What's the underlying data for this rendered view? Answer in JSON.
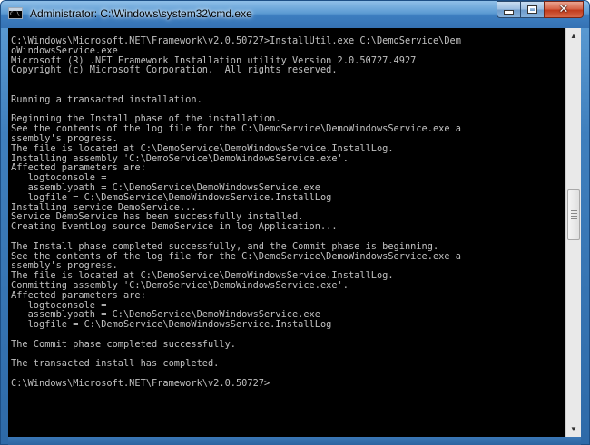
{
  "window": {
    "title": "Administrator: C:\\Windows\\system32\\cmd.exe",
    "icon": "cmd-icon",
    "icon_text": "C:\\"
  },
  "controls": {
    "minimize_icon": "minimize-icon",
    "maximize_icon": "maximize-icon",
    "close_icon": "close-icon",
    "close_glyph": "✕"
  },
  "console": {
    "lines": [
      "C:\\Windows\\Microsoft.NET\\Framework\\v2.0.50727>InstallUtil.exe C:\\DemoService\\Dem",
      "oWindowsService.exe",
      "Microsoft (R) .NET Framework Installation utility Version 2.0.50727.4927",
      "Copyright (c) Microsoft Corporation.  All rights reserved.",
      "",
      "",
      "Running a transacted installation.",
      "",
      "Beginning the Install phase of the installation.",
      "See the contents of the log file for the C:\\DemoService\\DemoWindowsService.exe a",
      "ssembly's progress.",
      "The file is located at C:\\DemoService\\DemoWindowsService.InstallLog.",
      "Installing assembly 'C:\\DemoService\\DemoWindowsService.exe'.",
      "Affected parameters are:",
      "   logtoconsole =",
      "   assemblypath = C:\\DemoService\\DemoWindowsService.exe",
      "   logfile = C:\\DemoService\\DemoWindowsService.InstallLog",
      "Installing service DemoService...",
      "Service DemoService has been successfully installed.",
      "Creating EventLog source DemoService in log Application...",
      "",
      "The Install phase completed successfully, and the Commit phase is beginning.",
      "See the contents of the log file for the C:\\DemoService\\DemoWindowsService.exe a",
      "ssembly's progress.",
      "The file is located at C:\\DemoService\\DemoWindowsService.InstallLog.",
      "Committing assembly 'C:\\DemoService\\DemoWindowsService.exe'.",
      "Affected parameters are:",
      "   logtoconsole =",
      "   assemblypath = C:\\DemoService\\DemoWindowsService.exe",
      "   logfile = C:\\DemoService\\DemoWindowsService.InstallLog",
      "",
      "The Commit phase completed successfully.",
      "",
      "The transacted install has completed.",
      "",
      "C:\\Windows\\Microsoft.NET\\Framework\\v2.0.50727>"
    ],
    "foreground": "#c0c0c0",
    "background": "#000000"
  },
  "scrollbar": {
    "up_icon": "scroll-up-arrow-icon",
    "down_icon": "scroll-down-arrow-icon",
    "up_glyph": "▲",
    "down_glyph": "▼"
  },
  "colors": {
    "titlebar": "#3c7dbf",
    "close_button": "#c13b1c"
  }
}
